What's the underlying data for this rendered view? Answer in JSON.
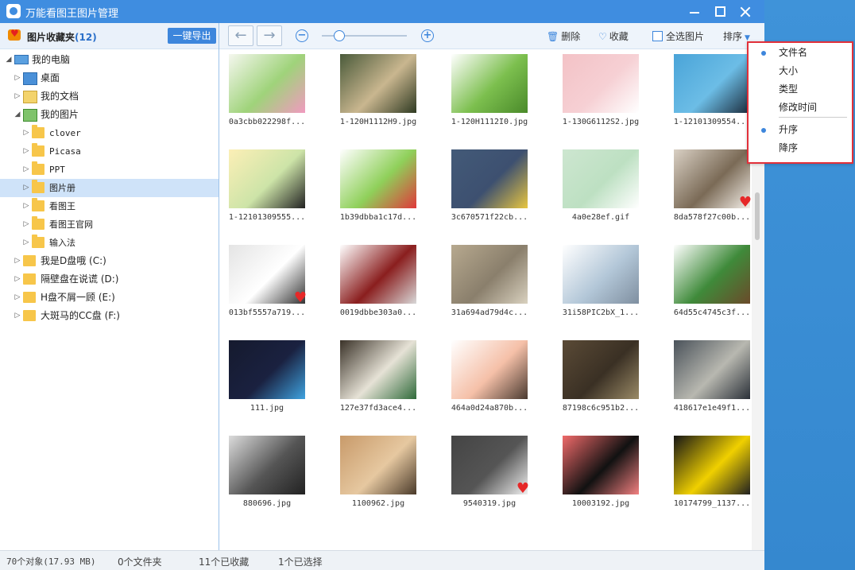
{
  "window": {
    "title": "万能看图王图片管理"
  },
  "favorites": {
    "label": "图片收藏夹",
    "count": "(12)",
    "export_label": "一键导出"
  },
  "tree": [
    {
      "label": "我的电脑",
      "level": 0,
      "expanded": true,
      "icon": "computer-icon"
    },
    {
      "label": "桌面",
      "level": 1,
      "expanded": false,
      "icon": "desktop-icon"
    },
    {
      "label": "我的文档",
      "level": 1,
      "expanded": false,
      "icon": "documents-icon"
    },
    {
      "label": "我的图片",
      "level": 1,
      "expanded": true,
      "icon": "pictures-icon"
    },
    {
      "label": "clover",
      "level": 2,
      "expanded": false,
      "icon": "folder-icon"
    },
    {
      "label": "Picasa",
      "level": 2,
      "expanded": false,
      "icon": "folder-icon"
    },
    {
      "label": "PPT",
      "level": 2,
      "expanded": false,
      "icon": "folder-icon"
    },
    {
      "label": "图片册",
      "level": 2,
      "expanded": false,
      "icon": "folder-icon",
      "selected": true
    },
    {
      "label": "看图王",
      "level": 2,
      "expanded": false,
      "icon": "folder-icon"
    },
    {
      "label": "看图王官网",
      "level": 2,
      "expanded": false,
      "icon": "folder-icon"
    },
    {
      "label": "输入法",
      "level": 2,
      "expanded": false,
      "icon": "folder-icon"
    },
    {
      "label": "我是D盘哦 (C:)",
      "level": 1,
      "expanded": false,
      "icon": "drive-icon"
    },
    {
      "label": "隔壁盘在说谎 (D:)",
      "level": 1,
      "expanded": false,
      "icon": "drive-icon"
    },
    {
      "label": "H盘不屑一顾 (E:)",
      "level": 1,
      "expanded": false,
      "icon": "drive-icon"
    },
    {
      "label": "大斑马的CC盘 (F:)",
      "level": 1,
      "expanded": false,
      "icon": "drive-icon"
    }
  ],
  "toolbar": {
    "back_icon": "arrow-left-icon",
    "forward_icon": "arrow-right-icon",
    "zoom_out_icon": "zoom-out-icon",
    "zoom_in_icon": "zoom-in-icon",
    "zoom_level": 0.2,
    "delete_label": "删除",
    "favorite_label": "收藏",
    "select_all_label": "全选图片",
    "sort_label": "排序"
  },
  "images": [
    {
      "name": "0a3cbb022298f...",
      "colors": [
        "#f5f7ef",
        "#9fd37a",
        "#f19ac0"
      ],
      "fav": false
    },
    {
      "name": "1-120H1112H9.jpg",
      "colors": [
        "#4a5a3a",
        "#c9b68f",
        "#2f3a22"
      ],
      "fav": false
    },
    {
      "name": "1-120H1112I0.jpg",
      "colors": [
        "#ffffff",
        "#7cbf4e",
        "#4a8a2a"
      ],
      "fav": false
    },
    {
      "name": "1-130G6112S2.jpg",
      "colors": [
        "#f3c2c6",
        "#f6d0d4",
        "#ffffff"
      ],
      "fav": false
    },
    {
      "name": "1-12101309554...",
      "colors": [
        "#4aa4d8",
        "#6cbde6",
        "#1a2a3a"
      ],
      "fav": false
    },
    {
      "name": "1-12101309555...",
      "colors": [
        "#fcefb6",
        "#cde4a8",
        "#222222"
      ],
      "fav": false
    },
    {
      "name": "1b39dbba1c17d...",
      "colors": [
        "#ffffff",
        "#8fd05a",
        "#e0383a"
      ],
      "fav": false
    },
    {
      "name": "3c670571f22cb...",
      "colors": [
        "#435a78",
        "#3d5070",
        "#e8c640"
      ],
      "fav": false
    },
    {
      "name": "4a0e28ef.gif",
      "colors": [
        "#cde6d0",
        "#bde0c2",
        "#ffffff"
      ],
      "fav": false
    },
    {
      "name": "8da578f27c00b...",
      "colors": [
        "#d9d0c4",
        "#7a6a56",
        "#f4efe8"
      ],
      "fav": true
    },
    {
      "name": "013bf5557a719...",
      "colors": [
        "#e4e4e4",
        "#ffffff",
        "#333333"
      ],
      "fav": true
    },
    {
      "name": "0019dbbe303a0...",
      "colors": [
        "#ffffff",
        "#8a1e1e",
        "#d8d8d8"
      ],
      "fav": false
    },
    {
      "name": "31a694ad79d4c...",
      "colors": [
        "#b7a98f",
        "#8a7f6c",
        "#d9d1bf"
      ],
      "fav": false
    },
    {
      "name": "31i58PIC2bX_1...",
      "colors": [
        "#ffffff",
        "#b3c7d8",
        "#7f8fa0"
      ],
      "fav": false
    },
    {
      "name": "64d55c4745c3f...",
      "colors": [
        "#ffffff",
        "#3f8a3a",
        "#6b4a2a"
      ],
      "fav": false
    },
    {
      "name": "111.jpg",
      "colors": [
        "#151a2e",
        "#1a2140",
        "#3fa3e0"
      ],
      "fav": false
    },
    {
      "name": "127e37fd3ace4...",
      "colors": [
        "#3a3228",
        "#e6e2d6",
        "#2f6a3a"
      ],
      "fav": false
    },
    {
      "name": "464a0d24a870b...",
      "colors": [
        "#ffffff",
        "#f5c0a8",
        "#4a3a30"
      ],
      "fav": false
    },
    {
      "name": "87198c6c951b2...",
      "colors": [
        "#5a4a36",
        "#3a3024",
        "#9a8a66"
      ],
      "fav": false
    },
    {
      "name": "418617e1e49f1...",
      "colors": [
        "#4a525a",
        "#b8b8b0",
        "#2a3038"
      ],
      "fav": false
    },
    {
      "name": "880696.jpg",
      "colors": [
        "#dcdcdc",
        "#555555",
        "#222222"
      ],
      "fav": false
    },
    {
      "name": "1100962.jpg",
      "colors": [
        "#c89a6a",
        "#e6c8a0",
        "#4a3a2a"
      ],
      "fav": false
    },
    {
      "name": "9540319.jpg",
      "colors": [
        "#444444",
        "#555555",
        "#f0f0f0"
      ],
      "fav": true
    },
    {
      "name": "10003192.jpg",
      "colors": [
        "#f06a6a",
        "#111111",
        "#f28080"
      ],
      "fav": false
    },
    {
      "name": "10174799_1137...",
      "colors": [
        "#151515",
        "#f0d000",
        "#202020"
      ],
      "fav": false
    }
  ],
  "status": {
    "objects": "70个对象(17.93 MB)",
    "folders": "0个文件夹",
    "favorited": "11个已收藏",
    "selected": "1个已选择"
  },
  "sort_menu": {
    "items": [
      {
        "label": "文件名",
        "checked": true
      },
      {
        "label": "大小",
        "checked": false
      },
      {
        "label": "类型",
        "checked": false
      },
      {
        "label": "修改时间",
        "checked": false
      }
    ],
    "order": [
      {
        "label": "升序",
        "checked": true
      },
      {
        "label": "降序",
        "checked": false
      }
    ]
  },
  "colors": {
    "accent": "#3d86dc",
    "title_bar": "#3f8de0",
    "highlight_border": "#e2303a"
  }
}
